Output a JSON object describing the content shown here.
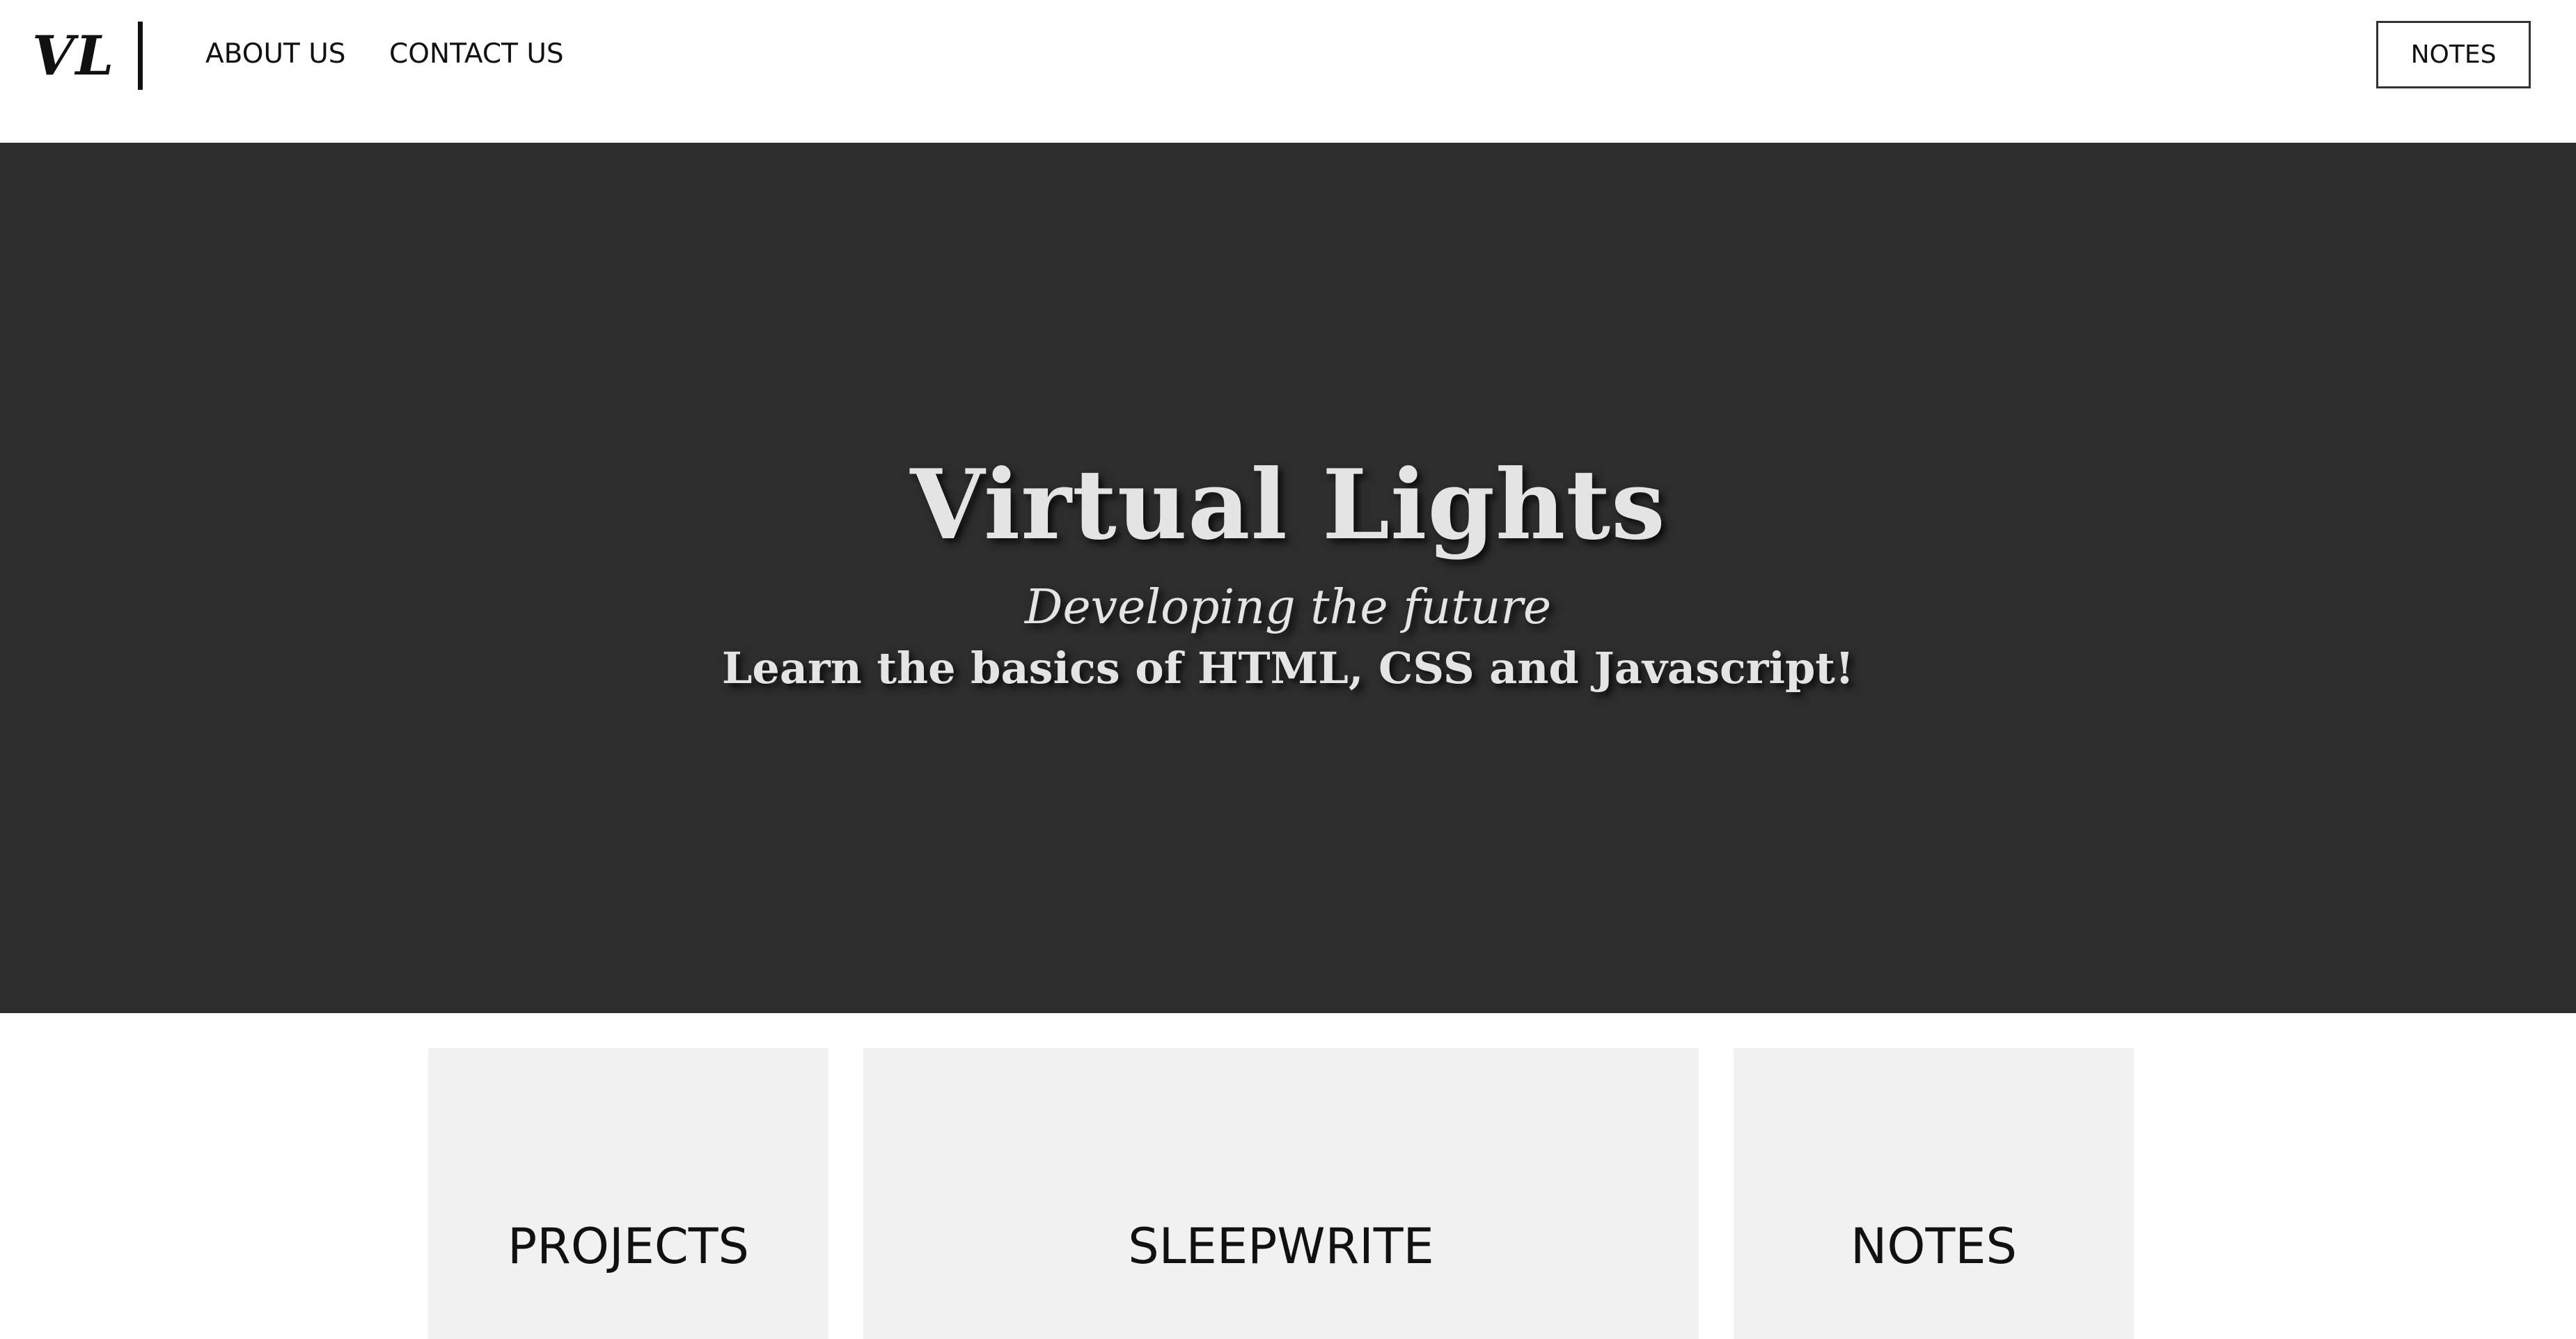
{
  "nav": {
    "logo_text": "VL",
    "links": [
      {
        "label": "ABOUT US"
      },
      {
        "label": "CONTACT US"
      }
    ],
    "notes_button_label": "NOTES"
  },
  "hero": {
    "title": "Virtual Lights",
    "tagline": "Developing the future",
    "subtitle": "Learn the basics of HTML, CSS and Javascript!"
  },
  "cards": [
    {
      "label": "PROJECTS"
    },
    {
      "label": "SLEEPWRITE"
    },
    {
      "label": "NOTES"
    }
  ],
  "colors": {
    "hero_background": "#2d2d2d",
    "hero_text": "#e4e4e4",
    "card_background": "#f1f1f1",
    "nav_background": "#ffffff",
    "text_dark": "#111111"
  }
}
